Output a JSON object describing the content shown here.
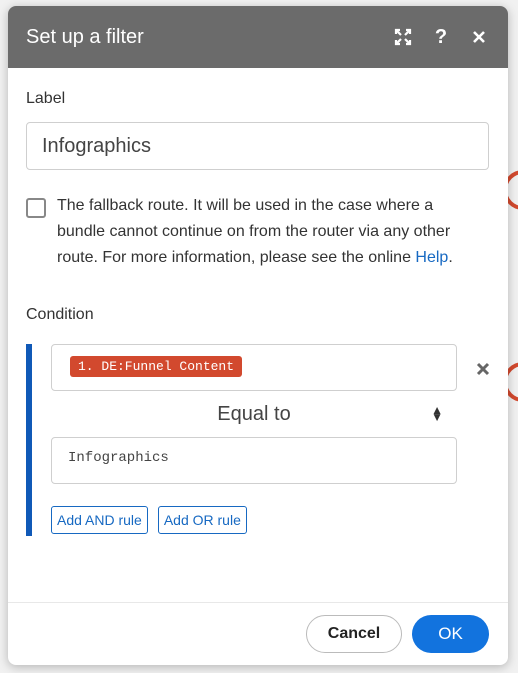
{
  "dialog": {
    "title": "Set up a filter",
    "icons": [
      "expand-icon",
      "help-icon",
      "close-icon"
    ]
  },
  "label_section": {
    "title": "Label",
    "value": "Infographics"
  },
  "fallback": {
    "checked": false,
    "text": "The fallback route. It will be used in the case where a bundle cannot continue on from the router via any other route. For more information, please see the online ",
    "link": "Help",
    "suffix": "."
  },
  "condition": {
    "title": "Condition",
    "field_pill": "1. DE:Funnel Content",
    "operator": "Equal to",
    "value": "Infographics",
    "add_and": "Add AND rule",
    "add_or": "Add OR rule"
  },
  "footer": {
    "cancel": "Cancel",
    "ok": "OK"
  },
  "colors": {
    "titlebar": "#6b6b6b",
    "accent": "#1769c2",
    "pill": "#d2492e",
    "ok_button": "#1273de"
  }
}
